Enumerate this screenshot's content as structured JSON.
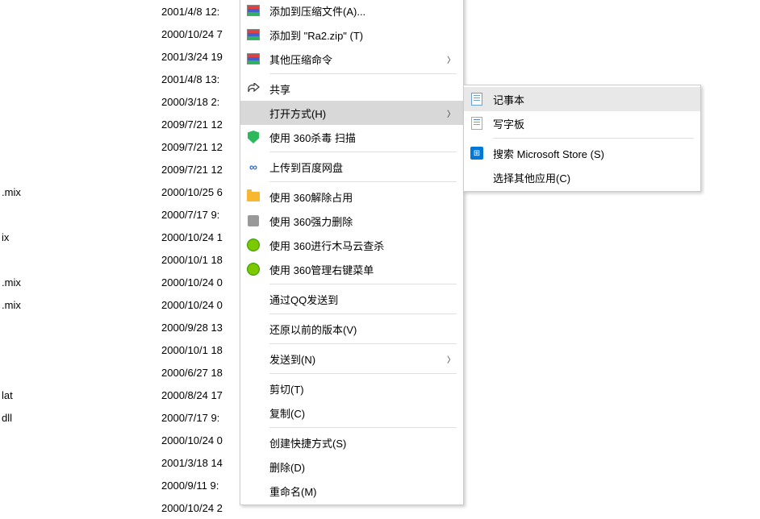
{
  "files": [
    {
      "name": "",
      "date": "2001/4/8 12:"
    },
    {
      "name": "",
      "date": "2000/10/24 7"
    },
    {
      "name": "",
      "date": "2001/3/24 19"
    },
    {
      "name": "",
      "date": "2001/4/8 13:"
    },
    {
      "name": "",
      "date": "2000/3/18 2:"
    },
    {
      "name": "",
      "date": "2009/7/21 12"
    },
    {
      "name": "",
      "date": "2009/7/21 12"
    },
    {
      "name": "",
      "date": "2009/7/21 12"
    },
    {
      "name": ".mix",
      "date": "2000/10/25 6"
    },
    {
      "name": "",
      "date": "2000/7/17 9:"
    },
    {
      "name": "ix",
      "date": "2000/10/24 1"
    },
    {
      "name": "",
      "date": "2000/10/1 18"
    },
    {
      "name": ".mix",
      "date": "2000/10/24 0"
    },
    {
      "name": ".mix",
      "date": "2000/10/24 0"
    },
    {
      "name": "",
      "date": "2000/9/28 13"
    },
    {
      "name": "",
      "date": "2000/10/1 18"
    },
    {
      "name": "",
      "date": "2000/6/27 18"
    },
    {
      "name": "lat",
      "date": "2000/8/24 17"
    },
    {
      "name": "dll",
      "date": "2000/7/17 9:"
    },
    {
      "name": "",
      "date": "2000/10/24 0"
    },
    {
      "name": "",
      "date": "2001/3/18 14"
    },
    {
      "name": "",
      "date": "2000/9/11 9:"
    },
    {
      "name": "",
      "date": "2000/10/24 2"
    }
  ],
  "contextMenu": {
    "items": [
      {
        "type": "item",
        "icon": "archive",
        "label": "添加到压缩文件(A)...",
        "arrow": false
      },
      {
        "type": "item",
        "icon": "archive",
        "label": "添加到 \"Ra2.zip\" (T)",
        "arrow": false
      },
      {
        "type": "item",
        "icon": "archive",
        "label": "其他压缩命令",
        "arrow": true
      },
      {
        "type": "sep"
      },
      {
        "type": "item",
        "icon": "share",
        "label": "共享",
        "arrow": false
      },
      {
        "type": "item",
        "icon": "",
        "label": "打开方式(H)",
        "arrow": true,
        "highlighted": true
      },
      {
        "type": "item",
        "icon": "shield",
        "label": "使用 360杀毒 扫描",
        "arrow": false
      },
      {
        "type": "sep"
      },
      {
        "type": "item",
        "icon": "baidu",
        "label": "上传到百度网盘",
        "arrow": false
      },
      {
        "type": "sep"
      },
      {
        "type": "item",
        "icon": "folder",
        "label": "使用 360解除占用",
        "arrow": false
      },
      {
        "type": "item",
        "icon": "shredder",
        "label": "使用 360强力删除",
        "arrow": false
      },
      {
        "type": "item",
        "icon": "360",
        "label": "使用 360进行木马云查杀",
        "arrow": false
      },
      {
        "type": "item",
        "icon": "360",
        "label": "使用 360管理右键菜单",
        "arrow": false
      },
      {
        "type": "sep"
      },
      {
        "type": "item",
        "icon": "",
        "label": "通过QQ发送到",
        "arrow": false
      },
      {
        "type": "sep"
      },
      {
        "type": "item",
        "icon": "",
        "label": "还原以前的版本(V)",
        "arrow": false
      },
      {
        "type": "sep"
      },
      {
        "type": "item",
        "icon": "",
        "label": "发送到(N)",
        "arrow": true
      },
      {
        "type": "sep"
      },
      {
        "type": "item",
        "icon": "",
        "label": "剪切(T)",
        "arrow": false
      },
      {
        "type": "item",
        "icon": "",
        "label": "复制(C)",
        "arrow": false
      },
      {
        "type": "sep"
      },
      {
        "type": "item",
        "icon": "",
        "label": "创建快捷方式(S)",
        "arrow": false
      },
      {
        "type": "item",
        "icon": "",
        "label": "删除(D)",
        "arrow": false
      },
      {
        "type": "item",
        "icon": "",
        "label": "重命名(M)",
        "arrow": false
      }
    ]
  },
  "submenu": {
    "items": [
      {
        "icon": "notepad",
        "label": "记事本",
        "highlighted": true
      },
      {
        "icon": "wordpad",
        "label": "写字板",
        "highlighted": false
      },
      {
        "type": "sep"
      },
      {
        "icon": "store",
        "label": "搜索 Microsoft Store (S)",
        "highlighted": false
      },
      {
        "icon": "",
        "label": "选择其他应用(C)",
        "highlighted": false
      }
    ]
  }
}
